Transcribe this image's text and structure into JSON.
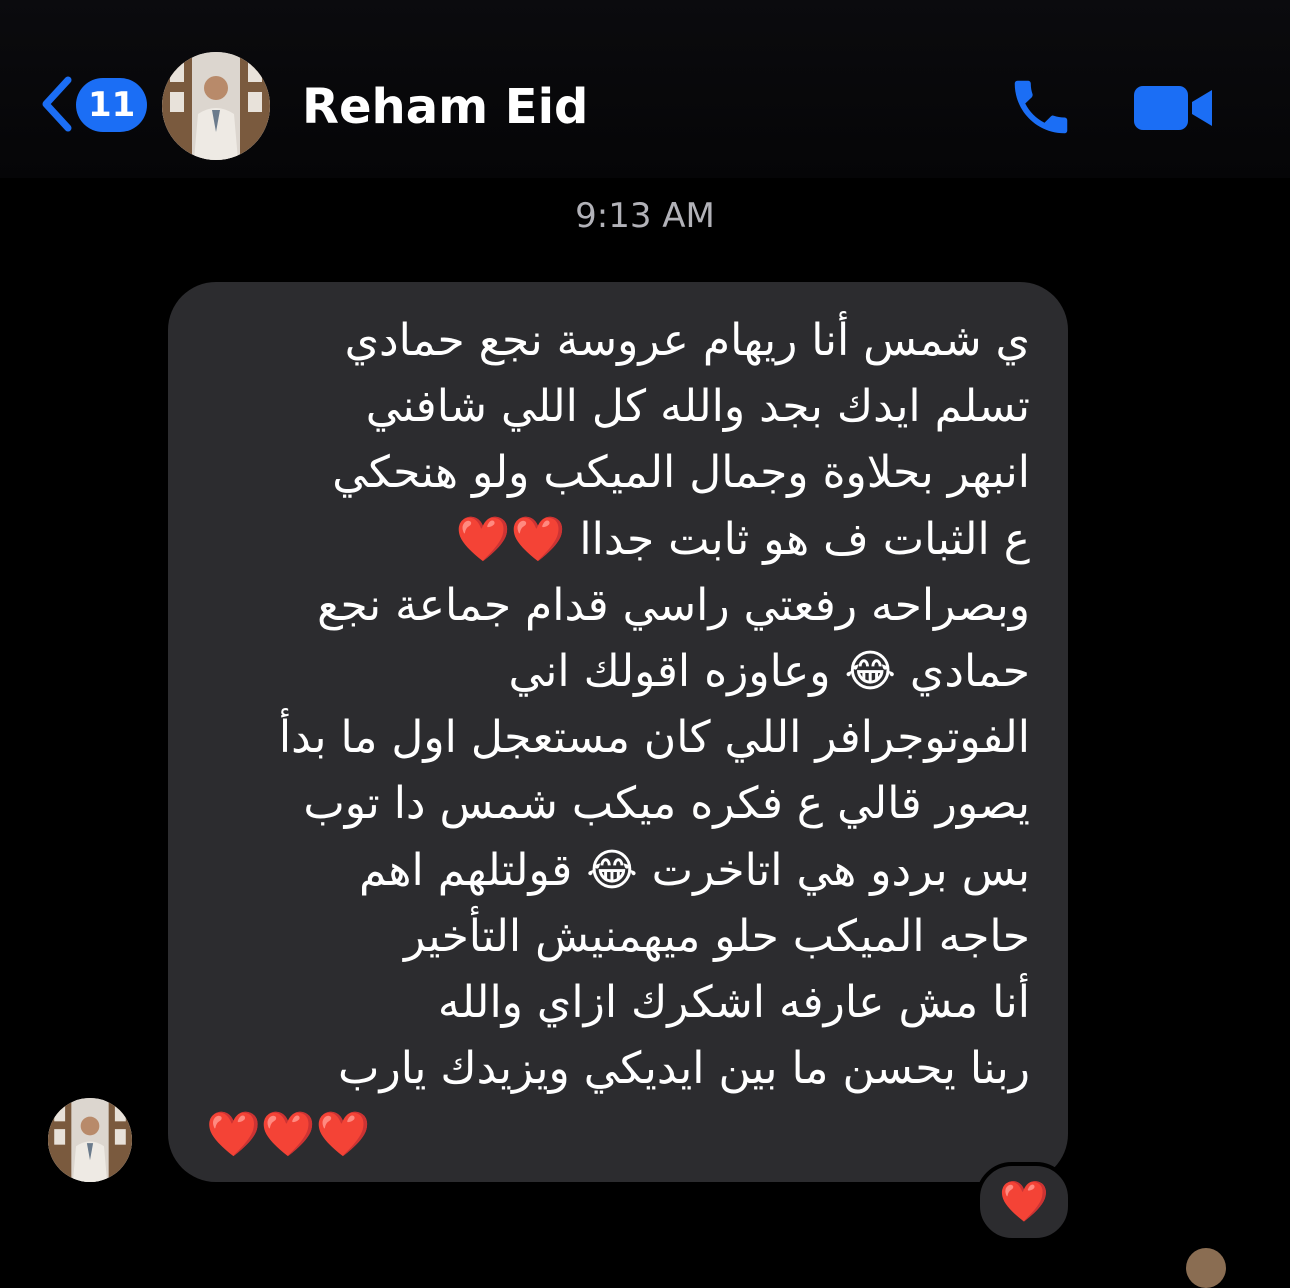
{
  "header": {
    "back_count": "11",
    "contact_name": "Reham Eid",
    "back_icon": "chevron-left-icon",
    "call_icon": "phone-icon",
    "video_icon": "video-camera-icon",
    "accent_color": "#1b6ef5"
  },
  "conversation": {
    "timestamp": "9:13 AM",
    "message": {
      "lines": [
        "ي شمس أنا ريهام عروسة نجع حمادي",
        "تسلم ايدك بجد والله كل اللي شافني",
        "انبهر بحلاوة وجمال الميكب ولو هنحكي",
        "ع الثبات ف هو ثابت جداا ❤️❤️",
        "وبصراحه رفعتي راسي قدام جماعة نجع",
        "حمادي 😂 وعاوزه اقولك اني",
        "الفوتوجرافر اللي كان مستعجل اول ما بدأ",
        "يصور قالي ع فكره ميكب شمس دا توب",
        "بس بردو هي اتاخرت 😂 قولتلهم اهم",
        "حاجه الميكب حلو ميهمنيش التأخير",
        "أنا مش عارفه اشكرك ازاي والله",
        "ربنا يحسن ما بين ايديكي ويزيدك يارب",
        "❤️❤️❤️"
      ],
      "bubble_color": "#2c2c2f"
    },
    "reaction": "❤️"
  }
}
